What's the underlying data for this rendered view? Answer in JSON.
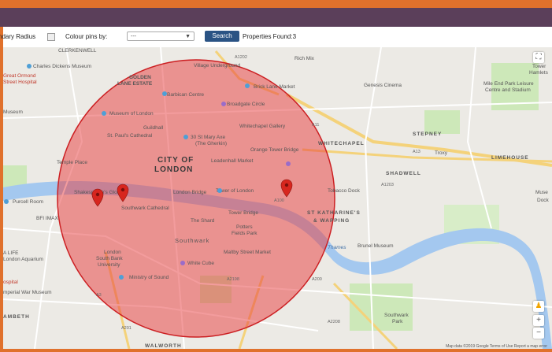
{
  "toolbar": {
    "boundary_label": "ndary Radius",
    "colour_label": "Colour pins by:",
    "select_value": "---",
    "search_label": "Search",
    "properties_found": "Properties Found:3"
  },
  "map": {
    "labels": {
      "clerkenwell": "CLERKENWELL",
      "charles_dickens": "Charles Dickens Museum",
      "golden_lane": "GOLDEN",
      "golden_lane2": "LANE ESTATE",
      "village_underground": "Village Underground",
      "rich_mix": "Rich Mix",
      "great_ormond": "Great Ormond",
      "street_hospital": "Street Hospital",
      "barbican": "Barbican Centre",
      "brick_lane": "Brick Lane Market",
      "genesis": "Genesis Cinema",
      "mile_end": "Mile End Park Leisure",
      "mile_end2": "Centre and Stadium",
      "museum": "Museum",
      "museum_london": "Museum of London",
      "broadgate": "Broadgate Circle",
      "guildhall": "Guildhall",
      "whitechapel_gallery": "Whitechapel Gallery",
      "stepney": "STEPNEY",
      "st_pauls": "St. Paul's Cathedral",
      "gherkin": "30 St Mary Axe",
      "gherkin2": "(The Gherkin)",
      "whitechapel": "WHITECHAPEL",
      "city_of": "CITY OF",
      "london": "LONDON",
      "leadenhall": "Leadenhall Market",
      "orange_tower": "Orange Tower Bridge",
      "troxy": "Troxy",
      "limehouse": "LIMEHOUSE",
      "temple": "Temple Place",
      "shadwell": "SHADWELL",
      "shakespeare": "Shakespeare's Globe",
      "london_bridge": "London Bridge",
      "tower_london": "Tower of London",
      "tobacco_dock": "Tobacco Dock",
      "purcell": "Purcell Room",
      "southwark_cathedral": "Southwark Cathedral",
      "bfi": "BFI IMAX",
      "the_shard": "The Shard",
      "tower_bridge": "Tower Bridge",
      "st_katharines": "ST KATHARINE'S",
      "wapping": "& WAPPING",
      "southwark": "Southwark",
      "potters": "Potters",
      "potters2": "Fields Park",
      "brunel": "Brunel Museum",
      "thames": "Thames",
      "a_life": "A LIFE",
      "aquarium": "London Aquarium",
      "lsbu": "London",
      "lsbu2": "South Bank",
      "lsbu3": "University",
      "maltby": "Maltby Street Market",
      "white_cube": "White Cube",
      "hospital": "ospital",
      "ministry": "Ministry of Sound",
      "iwm": "mperial War Museum",
      "lambeth": "AMBETH",
      "southwark_park": "Southwark",
      "southwark_park2": "Park",
      "walworth": "WALWORTH",
      "tower_hamlets": "Tower",
      "tower_hamlets2": "Hamlets",
      "muse": "Muse",
      "dock": "Dock"
    },
    "road_labels": {
      "a11": "A11",
      "a1202": "A1202",
      "a13": "A13",
      "a1203": "A1203",
      "a100": "A100",
      "a3": "A3",
      "a200": "A200",
      "a2198": "A2198",
      "a2208": "A2208",
      "a201": "A201"
    },
    "attribution": "Map data ©2019 Google   Terms of Use   Report a map error",
    "radius_fill": "#e8393b",
    "pin_color": "#d7261e"
  }
}
